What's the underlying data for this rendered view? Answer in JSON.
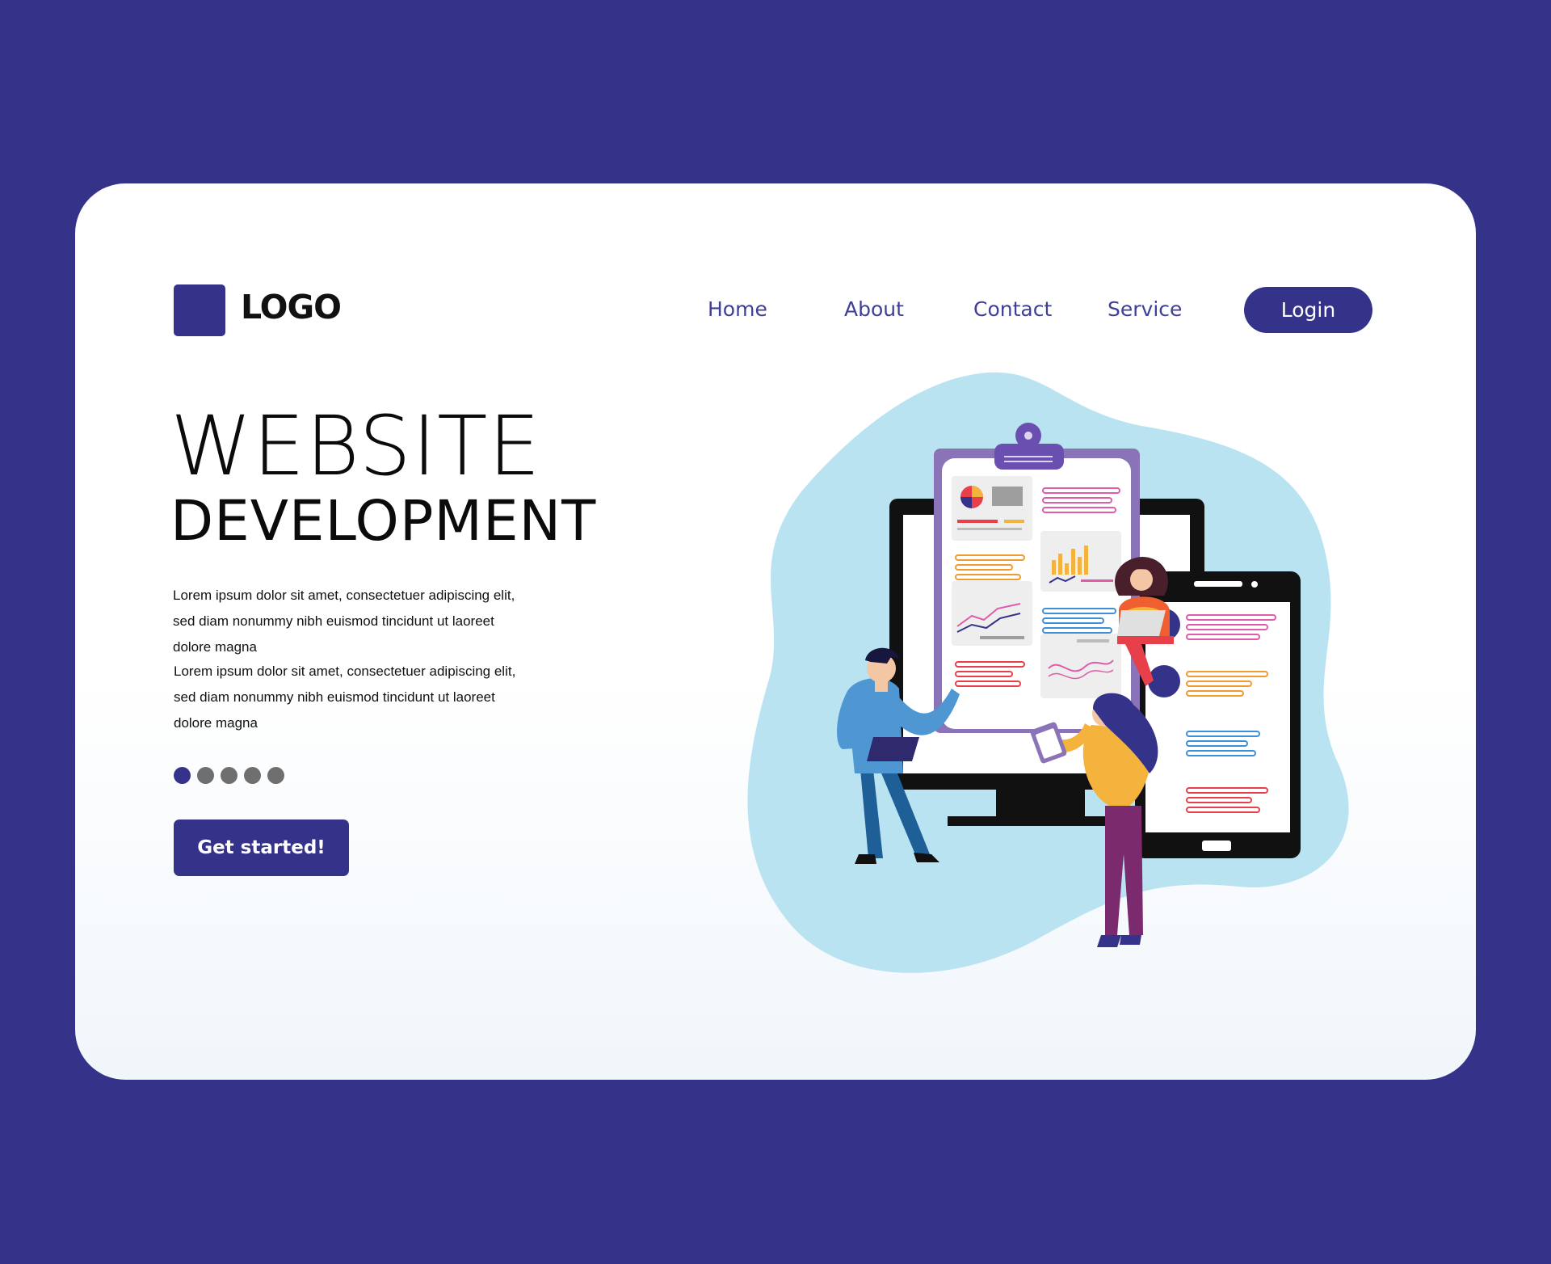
{
  "brand": {
    "logo_text": "LOGO"
  },
  "nav": {
    "items": [
      {
        "label": "Home"
      },
      {
        "label": "About"
      },
      {
        "label": "Contact"
      },
      {
        "label": "Service"
      }
    ],
    "login_label": "Login"
  },
  "hero": {
    "title": "WEBSITE",
    "subtitle": "DEVELOPMENT",
    "paragraphs": [
      {
        "lines": [
          "Lorem ipsum dolor sit amet, consectetuer adipiscing elit,",
          "sed diam nonummy nibh euismod tincidunt ut laoreet",
          "dolore magna"
        ]
      },
      {
        "lines": [
          "Lorem ipsum dolor sit amet, consectetuer adipiscing elit,",
          "sed diam nonummy nibh euismod tincidunt ut laoreet",
          "dolore magna"
        ]
      }
    ],
    "carousel": {
      "count": 5,
      "active_index": 0
    },
    "cta_label": "Get started!"
  },
  "colors": {
    "background": "#343389",
    "primary": "#343389",
    "nav_text": "#3f3f98",
    "blob": "#b9e3f1",
    "inactive_dot": "#6f6f6f"
  },
  "illustration": {
    "description_icons": [
      "monitor-icon",
      "clipboard-icon",
      "phone-icon",
      "laptop-icon"
    ]
  }
}
